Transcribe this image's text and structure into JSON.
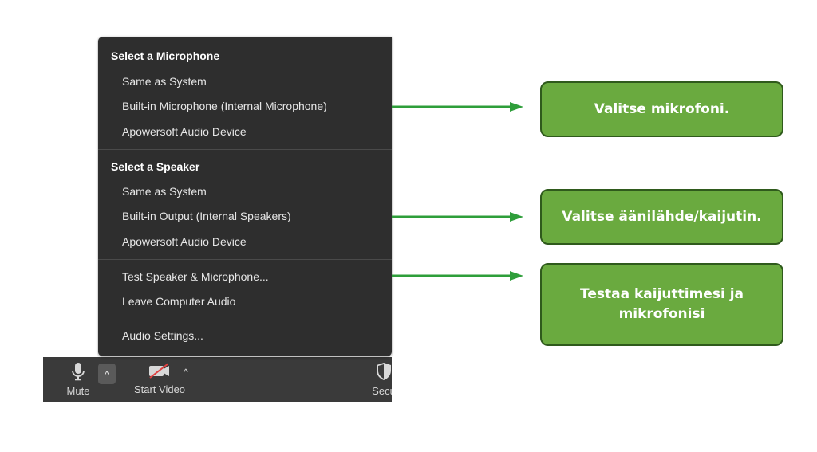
{
  "audio_menu": {
    "microphone_header": "Select a Microphone",
    "microphone_options": [
      "Same as System",
      "Built-in Microphone (Internal Microphone)",
      "Apowersoft Audio Device"
    ],
    "speaker_header": "Select a Speaker",
    "speaker_options": [
      "Same as System",
      "Built-in Output (Internal Speakers)",
      "Apowersoft Audio Device"
    ],
    "actions": [
      "Test Speaker & Microphone...",
      "Leave Computer Audio"
    ],
    "settings": "Audio Settings..."
  },
  "toolbar": {
    "mute_label": "Mute",
    "caret": "^",
    "start_video_label": "Start Video",
    "security_label": "Secu"
  },
  "callouts": [
    "Valitse mikrofoni.",
    "Valitse äänilähde/kaijutin.",
    "Testaa kaijuttimesi ja mikrofonisi"
  ],
  "colors": {
    "callout_fill": "#6aaa3f",
    "callout_border": "#2f5a1c",
    "arrow": "#2e9e3a",
    "menu_bg": "#2e2e2e",
    "toolbar_bg": "#3a3a3a"
  }
}
